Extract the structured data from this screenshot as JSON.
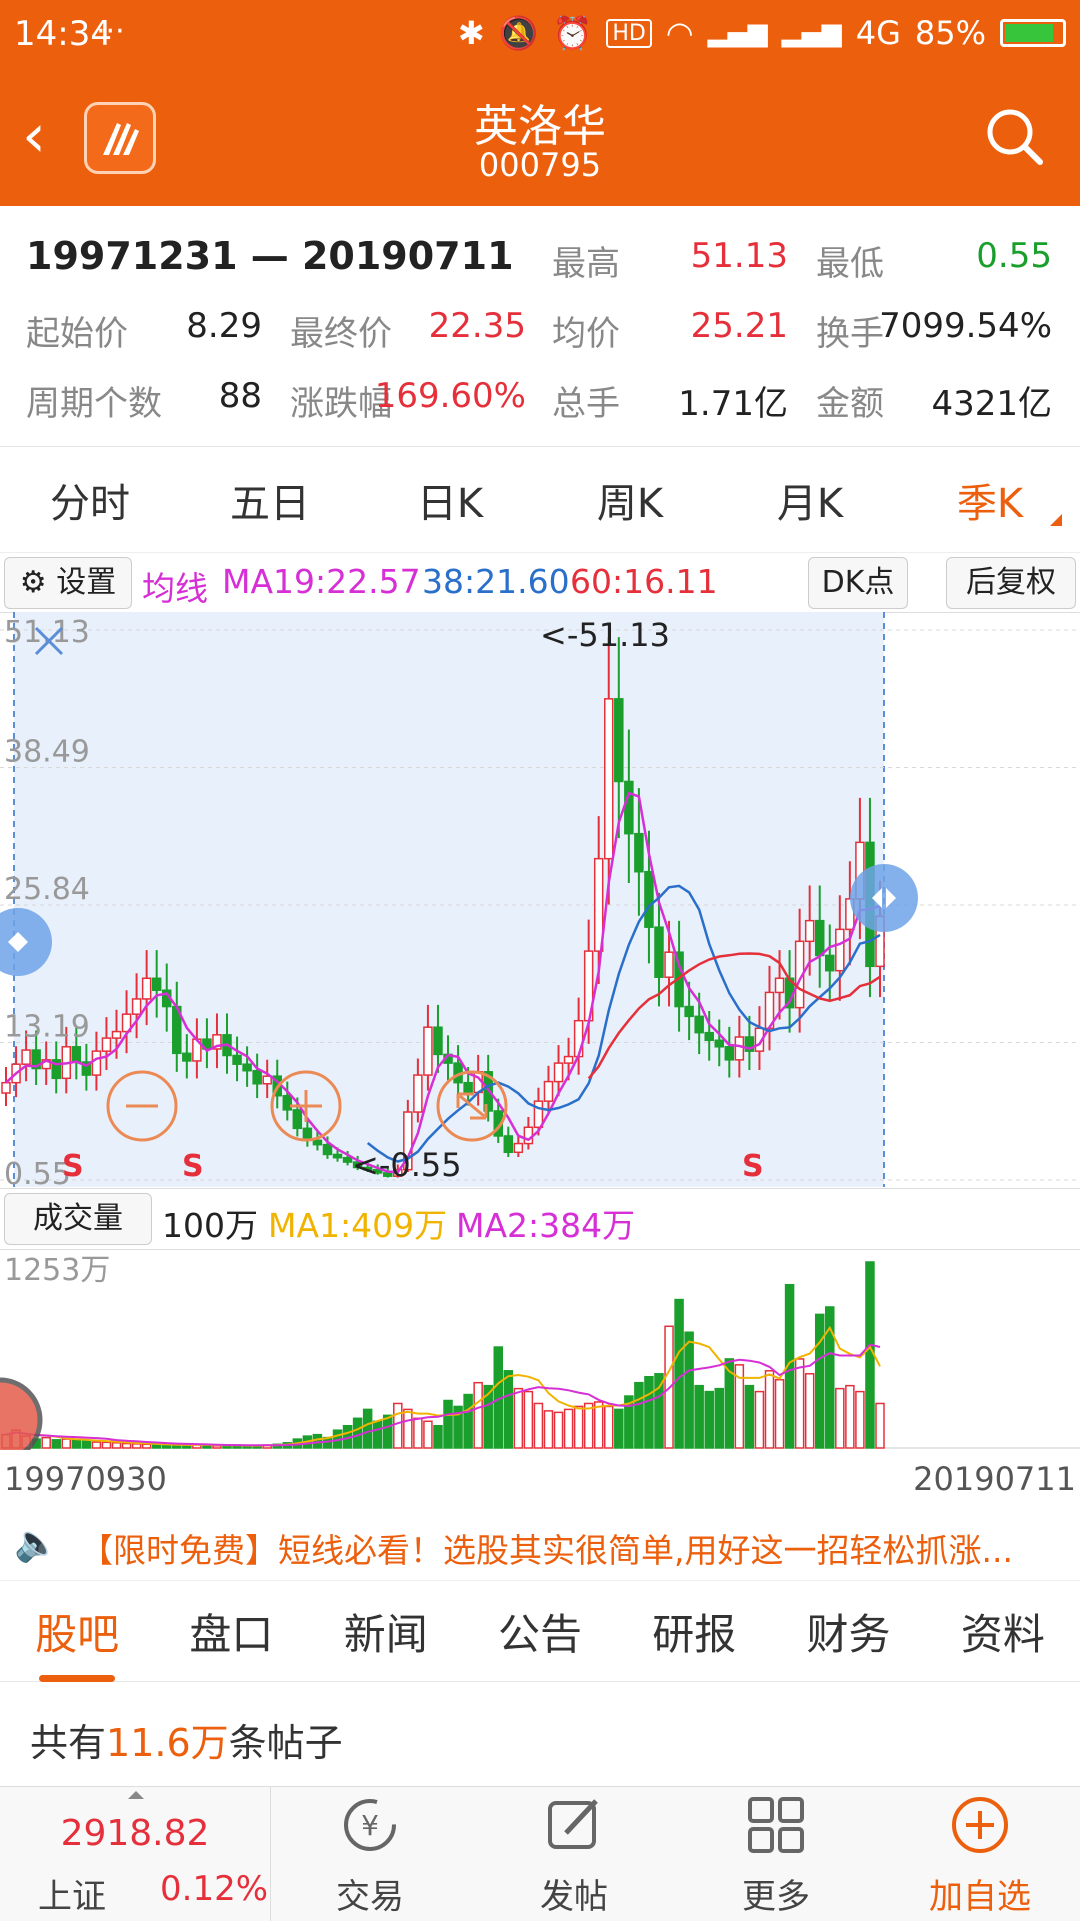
{
  "status": {
    "time": "14:34",
    "dots": "···",
    "network": "4G",
    "battery": "85%",
    "battery_level": 0.85
  },
  "nav": {
    "title": "英洛华",
    "code": "000795"
  },
  "stats": {
    "range": "19971231 — 20190711",
    "high_label": "最高",
    "high": "51.13",
    "low_label": "最低",
    "low": "0.55",
    "open_label": "起始价",
    "open": "8.29",
    "close_label": "最终价",
    "close": "22.35",
    "avg_label": "均价",
    "avg": "25.21",
    "turnover_label": "换手",
    "turnover": "7099.54%",
    "periods_label": "周期个数",
    "periods": "88",
    "change_label": "涨跌幅",
    "change": "169.60%",
    "hands_label": "总手",
    "hands": "1.71亿",
    "amount_label": "金额",
    "amount": "4321亿"
  },
  "period_tabs": [
    "分时",
    "五日",
    "日K",
    "周K",
    "月K",
    "季K"
  ],
  "active_period": 5,
  "ma_row": {
    "settings": "设置",
    "ma_label": "均线",
    "ma19": "MA19:22.57",
    "ma38": "38:21.60",
    "ma60": "60:16.11",
    "dk": "DK点",
    "adjust": "后复权"
  },
  "colors": {
    "accent": "#ec5f0d",
    "up": "#e5303b",
    "down": "#1a9e2c",
    "ma19": "#d62fd6",
    "ma38": "#2a6fc9",
    "ma60": "#e5303b",
    "ma1": "#f0b400"
  },
  "kchart": {
    "y_ticks": [
      "51.13",
      "38.49",
      "25.84",
      "13.19",
      "0.55"
    ],
    "max_annotation": "<-51.13",
    "min_annotation": "<-0.55",
    "s_marks": [
      "S",
      "S",
      "S"
    ]
  },
  "volume": {
    "label": "成交量",
    "unit": "100万",
    "ma1": "MA1:409万",
    "ma2": "MA2:384万",
    "y_top": "1253万"
  },
  "dates": {
    "start": "19970930",
    "end": "20190711"
  },
  "ad": "【限时免费】短线必看！选股其实很简单,用好这一招轻松抓涨...",
  "info_tabs": [
    "股吧",
    "盘口",
    "新闻",
    "公告",
    "研报",
    "财务",
    "资料"
  ],
  "posts": {
    "prefix": "共有",
    "count": "11.6万",
    "suffix": "条帖子"
  },
  "bottom": {
    "index_value": "2918.82",
    "index_name": "上证",
    "index_change": "0.12%",
    "trade": "交易",
    "post": "发帖",
    "more": "更多",
    "add": "加自选"
  },
  "chart_data": {
    "type": "candlestick",
    "title": "",
    "ylim": [
      0.55,
      51.13
    ],
    "y_ticks": [
      51.13,
      38.49,
      25.84,
      13.19,
      0.55
    ],
    "x_start": "19970930",
    "x_end": "20190711",
    "series": [
      {
        "name": "MA19",
        "last": 22.57
      },
      {
        "name": "38",
        "last": 21.6
      },
      {
        "name": "60",
        "last": 16.11
      }
    ],
    "close_series": [
      9.5,
      11.2,
      12.5,
      10.8,
      11.6,
      9.9,
      12.8,
      11.4,
      10.2,
      12.4,
      13.6,
      14.2,
      15.8,
      17.2,
      19.1,
      18.0,
      16.5,
      12.2,
      11.5,
      13.5,
      12.6,
      13.9,
      12.0,
      11.2,
      10.6,
      9.4,
      10.1,
      8.3,
      7.0,
      5.3,
      4.2,
      3.8,
      2.9,
      2.6,
      2.2,
      1.7,
      1.5,
      1.2,
      0.9,
      1.5,
      6.8,
      10.2,
      14.6,
      12.1,
      11.3,
      9.5,
      8.6,
      10.5,
      6.9,
      4.6,
      3.1,
      3.9,
      5.4,
      7.8,
      9.6,
      11.3,
      11.9,
      15.2,
      21.6,
      30.1,
      44.8,
      37.2,
      32.4,
      28.9,
      23.8,
      19.2,
      21.5,
      16.5,
      15.6,
      14.1,
      13.4,
      12.8,
      11.6,
      13.7,
      12.4,
      14.5,
      17.8,
      19.1,
      16.4,
      22.5,
      24.4,
      21.2,
      19.8,
      23.6,
      26.4,
      31.6,
      20.2,
      24.8
    ],
    "volume_series_wan": [
      90,
      120,
      80,
      60,
      70,
      55,
      60,
      50,
      45,
      40,
      38,
      35,
      30,
      28,
      25,
      20,
      18,
      20,
      22,
      25,
      18,
      15,
      12,
      20,
      15,
      18,
      20,
      25,
      35,
      60,
      80,
      90,
      70,
      120,
      150,
      200,
      260,
      180,
      220,
      300,
      260,
      200,
      180,
      150,
      320,
      280,
      360,
      440,
      420,
      680,
      520,
      400,
      380,
      300,
      250,
      240,
      260,
      280,
      300,
      310,
      280,
      260,
      350,
      440,
      480,
      500,
      820,
      1000,
      780,
      420,
      380,
      400,
      600,
      560,
      420,
      380,
      520,
      460,
      1100,
      600,
      500,
      900,
      950,
      400,
      420,
      380,
      1253,
      300
    ]
  }
}
